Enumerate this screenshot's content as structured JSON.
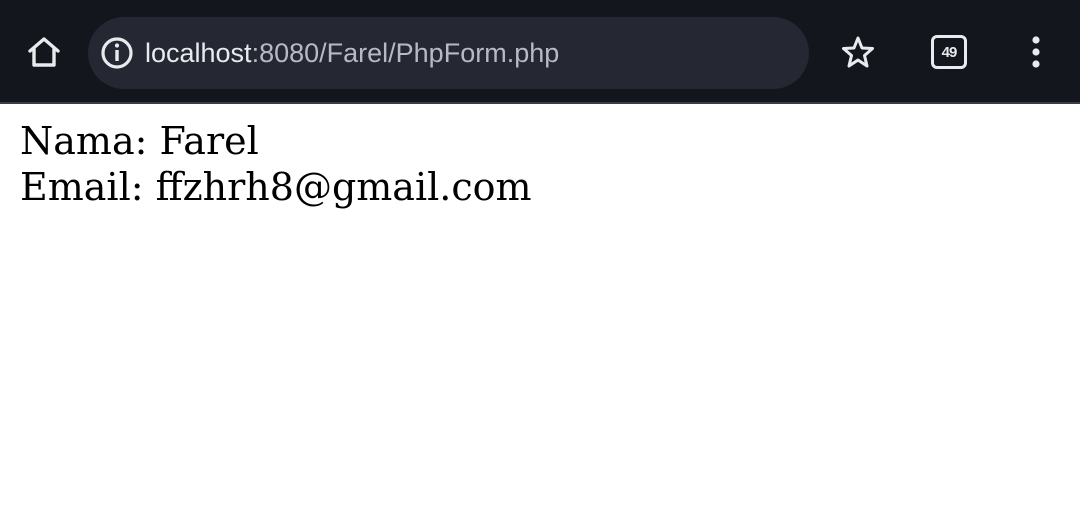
{
  "browser": {
    "url_host": "localhost",
    "url_path": ":8080/Farel/PhpForm.php",
    "tab_count": "49",
    "icons": {
      "home": "home-icon",
      "info": "info-icon",
      "star": "star-icon",
      "tabs": "tab-switcher-icon",
      "menu": "more-vert-icon"
    },
    "colors": {
      "toolbar_bg": "#14161d",
      "omnibox_bg": "#252833",
      "icon": "#e8eaed"
    }
  },
  "page": {
    "lines": [
      {
        "label": "Nama:",
        "value": "Farel"
      },
      {
        "label": "Email:",
        "value": "ffzhrh8@gmail.com"
      }
    ]
  }
}
